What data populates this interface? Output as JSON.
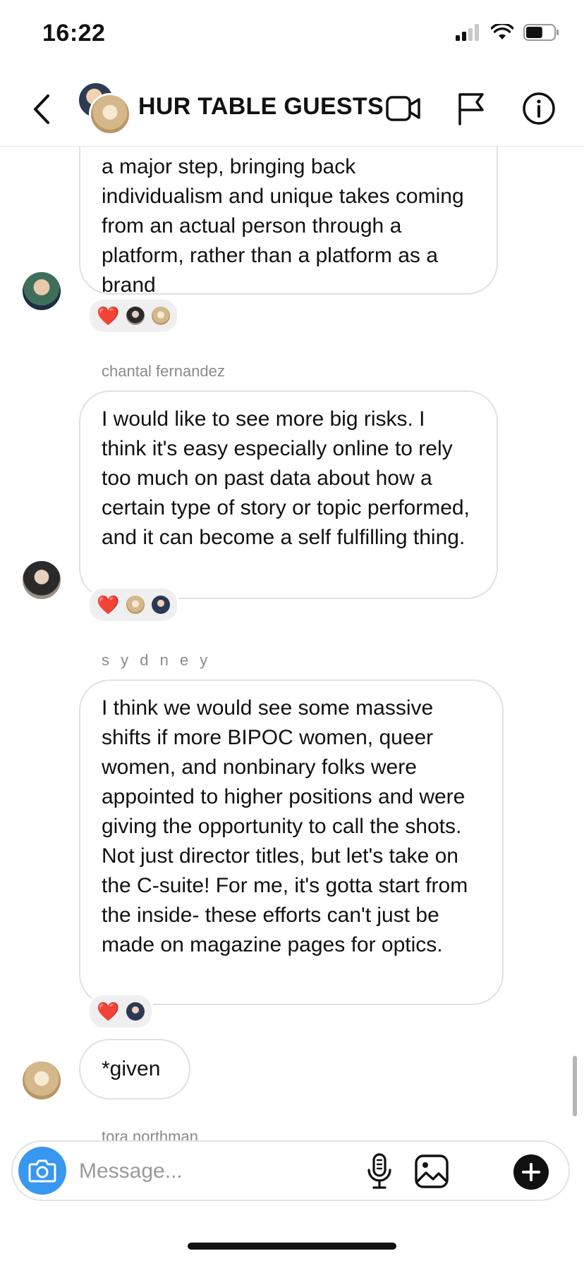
{
  "status_bar": {
    "time": "16:22",
    "battery_percent": 60
  },
  "header": {
    "back_icon": "chevron-left-icon",
    "title": "HUR TABLE GUESTS",
    "icons": [
      "video-camera-icon",
      "flag-icon",
      "info-icon"
    ]
  },
  "messages": [
    {
      "sender": "",
      "text": "a major step, bringing back individualism and unique takes coming from an actual person through a platform, rather than a platform as a brand",
      "reactions": [
        "❤️"
      ]
    },
    {
      "sender": "chantal fernandez",
      "text": "I would like to see more big risks. I think it's easy especially online to rely too much on past data about how a certain type of story or topic performed, and it can become a self fulfilling thing.",
      "reactions": [
        "❤️"
      ]
    },
    {
      "sender": "s y d n e y",
      "text": "I think we would see some massive shifts if more BIPOC women, queer women, and nonbinary folks were appointed to higher positions and were giving the opportunity to call the shots. Not just director titles, but let's take on the C-suite! For me, it's gotta start from the inside- these efforts can't just be made on magazine pages for optics.",
      "reactions": [
        "❤️"
      ]
    },
    {
      "sender": "",
      "text": "*given"
    },
    {
      "sender": "tora northman"
    }
  ],
  "composer": {
    "placeholder": "Message...",
    "icons": [
      "camera-icon",
      "microphone-icon",
      "image-icon",
      "plus-icon"
    ]
  }
}
